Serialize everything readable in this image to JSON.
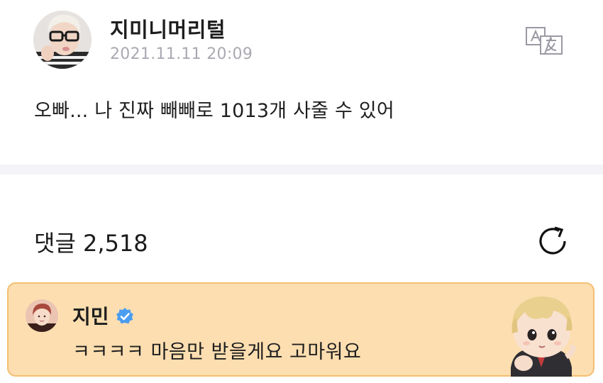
{
  "post": {
    "author": "지미니머리털",
    "date": "2021.11.11 20:09",
    "body": "오빠... 나 진짜 빼빼로 1013개 사줄 수 있어",
    "translate_icon": "translate-icon"
  },
  "comments": {
    "title": "댓글 2,518",
    "refresh_icon": "refresh-icon"
  },
  "pinned_comment": {
    "author": "지민",
    "verified_icon": "verified-badge-icon",
    "text": "ㅋㅋㅋㅋ 마음만 받을게요 고마워요",
    "sticker": "character-sticker"
  },
  "colors": {
    "card_background": "#fddeb0",
    "card_border": "#f2bf72",
    "verified_blue": "#4a9df0",
    "date_gray": "#a9a9b2",
    "divider": "#f4f4f8"
  }
}
